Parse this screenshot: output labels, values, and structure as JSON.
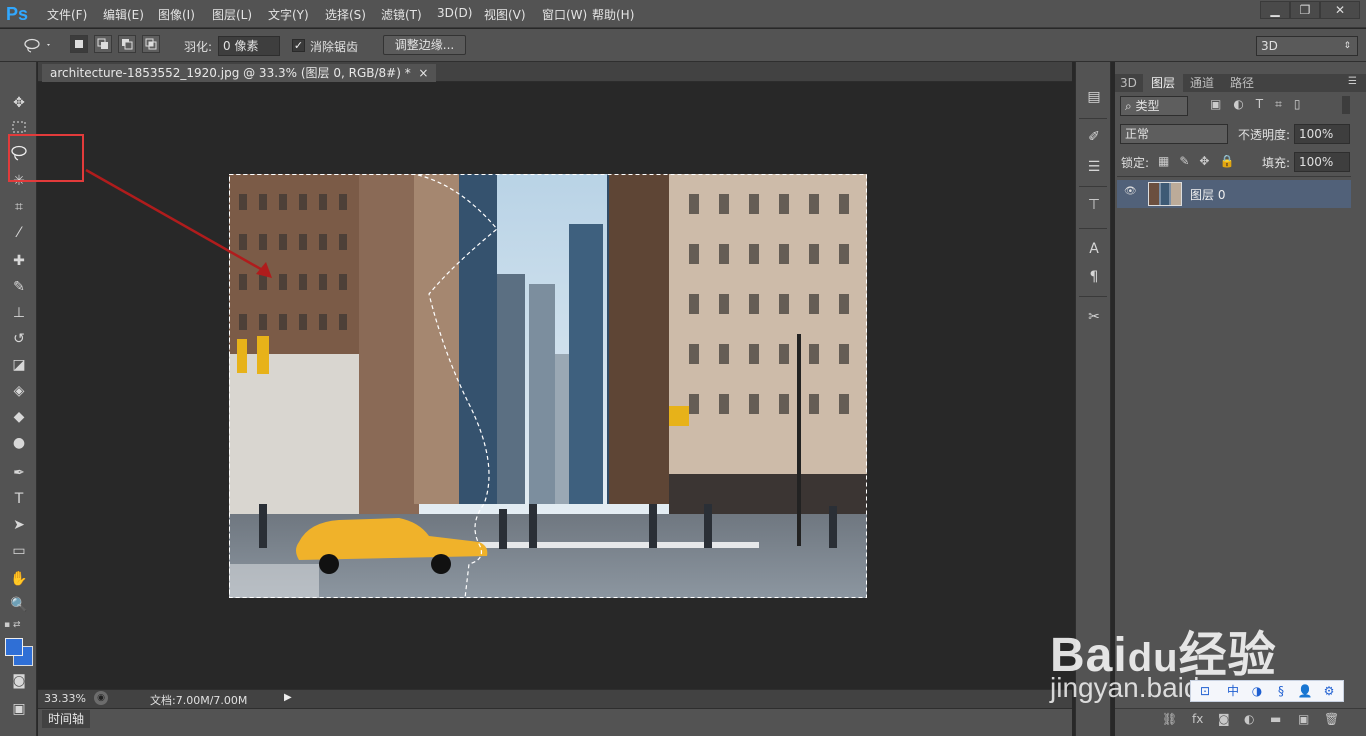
{
  "app": {
    "logo": "Ps"
  },
  "menu": [
    "文件(F)",
    "编辑(E)",
    "图像(I)",
    "图层(L)",
    "文字(Y)",
    "选择(S)",
    "滤镜(T)",
    "3D(D)",
    "视图(V)",
    "窗口(W)",
    "帮助(H)"
  ],
  "window_controls": {
    "minimize": "▁",
    "restore": "❐",
    "close": "✕"
  },
  "options": {
    "feather_label": "羽化:",
    "feather_value": "0 像素",
    "antialias_label": "消除锯齿",
    "antialias_checked": "✓",
    "refine_edge_button": "调整边缘...",
    "workspace_value": "3D"
  },
  "document": {
    "tab_title": "architecture-1853552_1920.jpg @ 33.3% (图层 0, RGB/8#) *",
    "tab_close": "×"
  },
  "status": {
    "zoom": "33.33%",
    "doc_size": "文档:7.00M/7.00M"
  },
  "timeline": {
    "label": "时间轴"
  },
  "panel_tabs": [
    "3D",
    "图层",
    "通道",
    "路径"
  ],
  "layers": {
    "filter_kind": "类型",
    "blend_mode": "正常",
    "opacity_label": "不透明度:",
    "opacity_value": "100%",
    "lock_label": "锁定:",
    "fill_label": "填充:",
    "fill_value": "100%",
    "rows": [
      {
        "name": "图层 0",
        "visible": "👁"
      }
    ]
  },
  "watermark": {
    "brand": "Bai",
    "brand_suffix": "经验",
    "sub": "jingyan.baidu"
  },
  "ime": {
    "lang": "中"
  },
  "colors": {
    "accent": "#31a8ff",
    "highlight": "#e23b3b",
    "selected_layer": "#516179"
  }
}
